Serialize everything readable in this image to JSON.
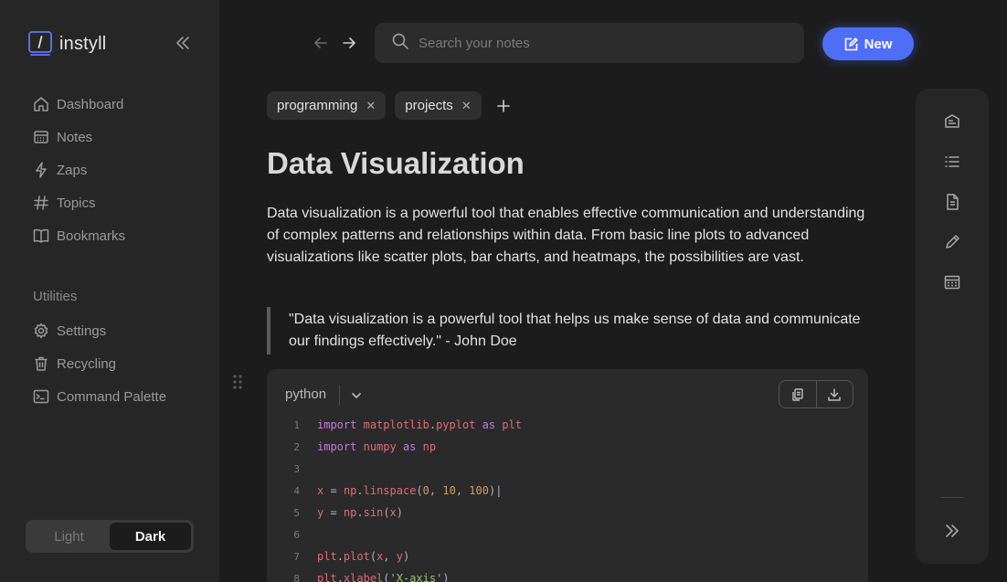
{
  "app": {
    "name": "instyll"
  },
  "sidebar": {
    "items": [
      {
        "label": "Dashboard",
        "icon": "home-icon"
      },
      {
        "label": "Notes",
        "icon": "notes-icon"
      },
      {
        "label": "Zaps",
        "icon": "lightning-icon"
      },
      {
        "label": "Topics",
        "icon": "hash-icon"
      },
      {
        "label": "Bookmarks",
        "icon": "book-icon"
      }
    ],
    "utilities_label": "Utilities",
    "utilities": [
      {
        "label": "Settings",
        "icon": "gear-icon"
      },
      {
        "label": "Recycling",
        "icon": "trash-icon"
      },
      {
        "label": "Command Palette",
        "icon": "terminal-icon"
      }
    ],
    "theme": {
      "light": "Light",
      "dark": "Dark",
      "selected": "Dark"
    }
  },
  "topbar": {
    "search_placeholder": "Search your notes",
    "new_label": "New"
  },
  "tags": [
    "programming",
    "projects"
  ],
  "note": {
    "title": "Data Visualization",
    "paragraph": "Data visualization is a powerful tool that enables effective communication and understanding of complex patterns and relationships within data. From basic line plots to advanced visualizations like scatter plots, bar charts, and heatmaps, the possibilities are vast.",
    "quote": "\"Data visualization is a powerful tool that helps us make sense of data and communicate our findings effectively.\" - John Doe"
  },
  "code": {
    "language": "python",
    "lines": [
      {
        "n": "1",
        "text": "import matplotlib.pyplot as plt"
      },
      {
        "n": "2",
        "text": "import numpy as np"
      },
      {
        "n": "3",
        "text": ""
      },
      {
        "n": "4",
        "text": "x = np.linspace(0, 10, 100)"
      },
      {
        "n": "5",
        "text": "y = np.sin(x)"
      },
      {
        "n": "6",
        "text": ""
      },
      {
        "n": "7",
        "text": "plt.plot(x, y)"
      },
      {
        "n": "8",
        "text": "plt.xlabel('X-axis')"
      }
    ]
  },
  "colors": {
    "accent": "#4f6ef7",
    "background": "#1c1c1c",
    "sidebar": "#262626"
  },
  "right_panel": {
    "icons": [
      "outline-icon",
      "list-icon",
      "document-icon",
      "pencil-icon",
      "table-icon",
      "expand-icon"
    ]
  }
}
